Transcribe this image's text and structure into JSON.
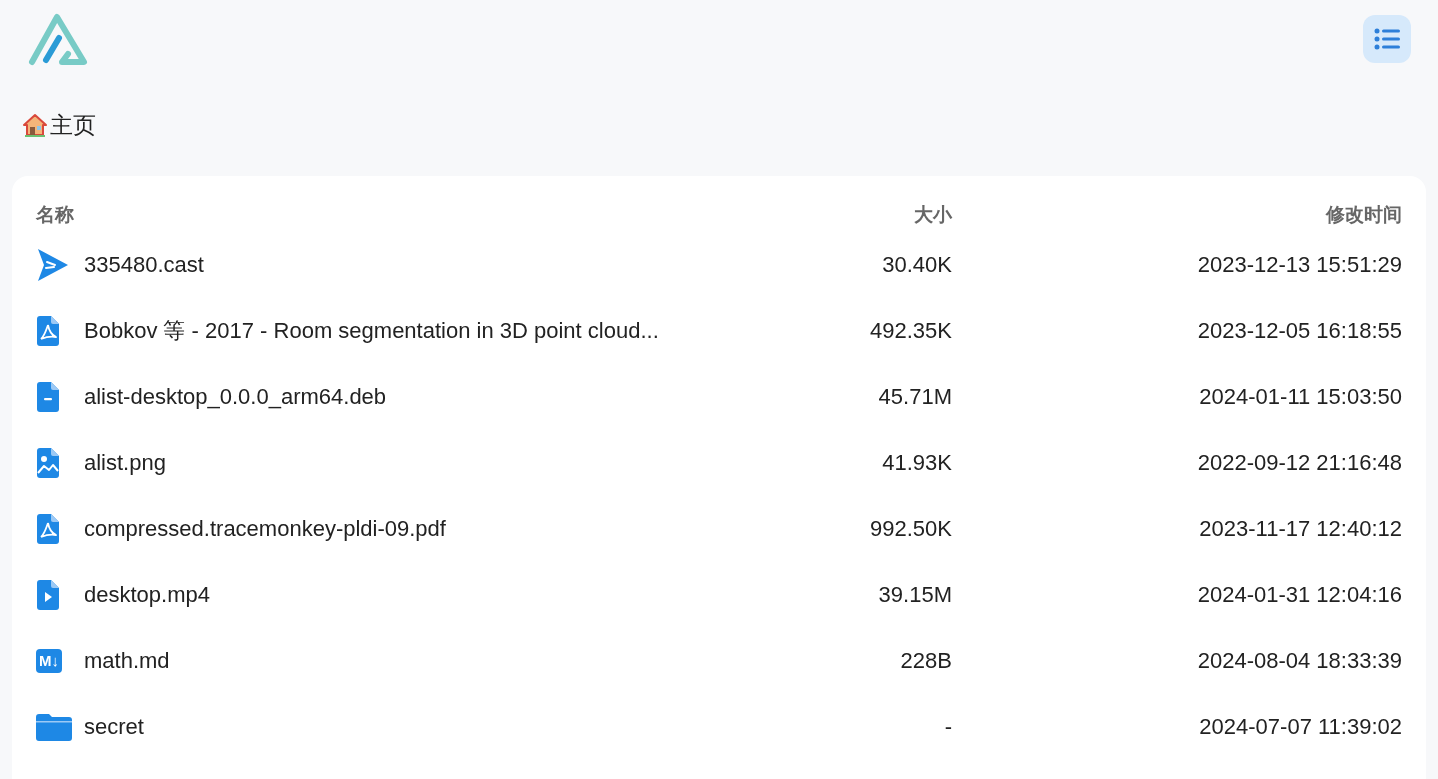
{
  "breadcrumb": {
    "label": "主页"
  },
  "table": {
    "columns": [
      "名称",
      "大小",
      "修改时间"
    ],
    "rows": [
      {
        "kind": "cast",
        "name": "335480.cast",
        "size": "30.40K",
        "modified": "2023-12-13 15:51:29"
      },
      {
        "kind": "pdf",
        "name": "Bobkov 等 - 2017 - Room segmentation in 3D point cloud...",
        "size": "492.35K",
        "modified": "2023-12-05 16:18:55"
      },
      {
        "kind": "file",
        "name": "alist-desktop_0.0.0_arm64.deb",
        "size": "45.71M",
        "modified": "2024-01-11 15:03:50"
      },
      {
        "kind": "image",
        "name": "alist.png",
        "size": "41.93K",
        "modified": "2022-09-12 21:16:48"
      },
      {
        "kind": "pdf",
        "name": "compressed.tracemonkey-pldi-09.pdf",
        "size": "992.50K",
        "modified": "2023-11-17 12:40:12"
      },
      {
        "kind": "video",
        "name": "desktop.mp4",
        "size": "39.15M",
        "modified": "2024-01-31 12:04:16"
      },
      {
        "kind": "markdown",
        "icon_text": "M↓",
        "name": "math.md",
        "size": "228B",
        "modified": "2024-08-04 18:33:39"
      },
      {
        "kind": "folder",
        "name": "secret",
        "size": "-",
        "modified": "2024-07-07 11:39:02"
      }
    ]
  }
}
